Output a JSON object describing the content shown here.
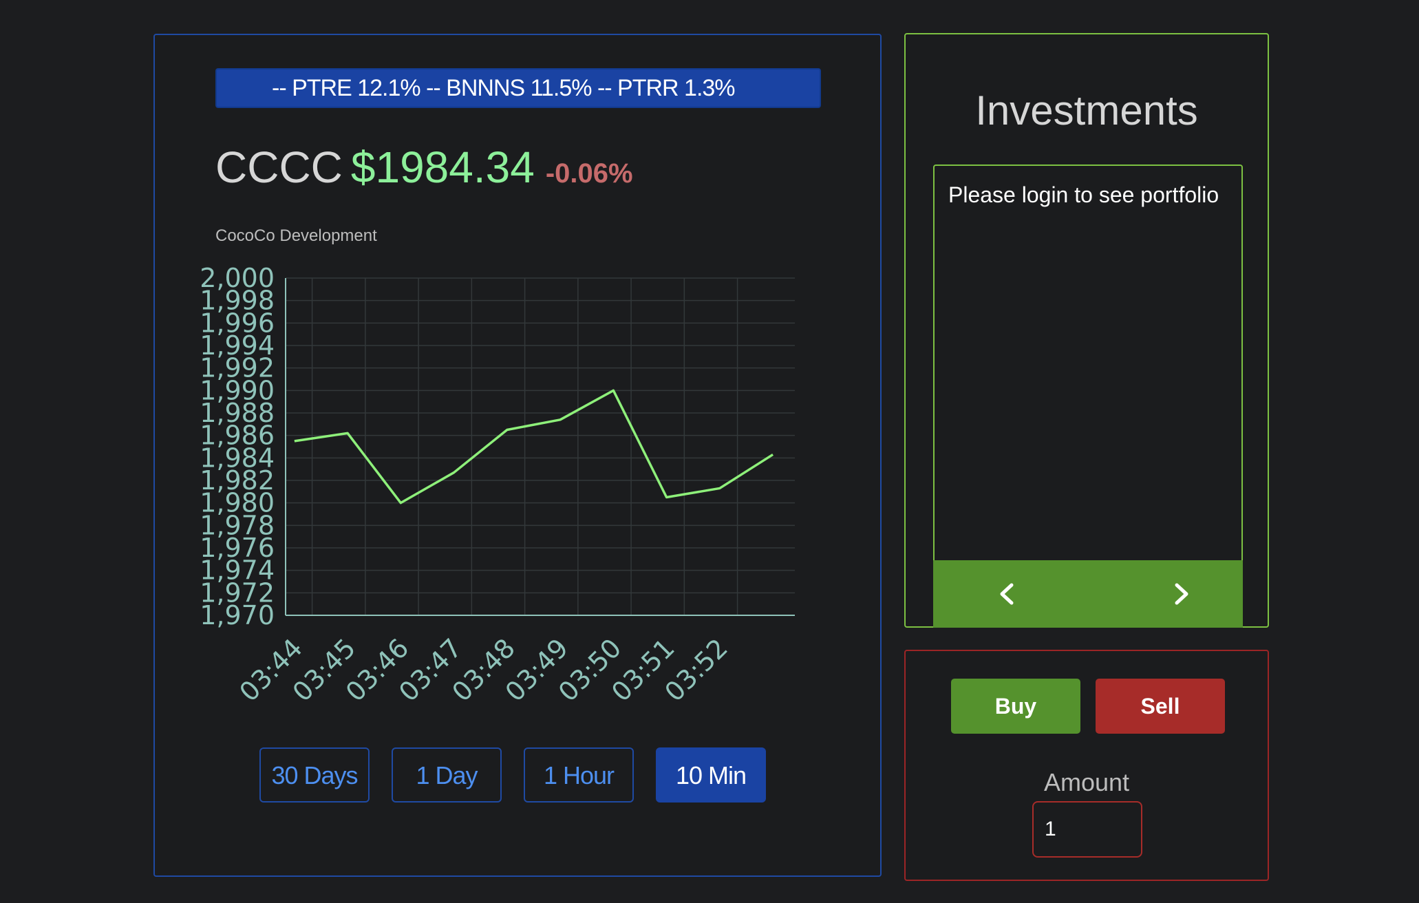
{
  "ticker": {
    "text": "-- PTRE 12.1% -- BNNNS 11.5% -- PTRR 1.3%"
  },
  "quote": {
    "symbol": "CCCC",
    "price": "$1984.34",
    "change": "-0.06%",
    "company": "CocoCo Development"
  },
  "chart_data": {
    "type": "line",
    "x": [
      "03:44",
      "03:45",
      "03:46",
      "03:47",
      "03:48",
      "03:49",
      "03:50",
      "03:51",
      "03:52"
    ],
    "y_ticks": [
      "2,000",
      "1,998",
      "1,996",
      "1,994",
      "1,992",
      "1,990",
      "1,988",
      "1,986",
      "1,984",
      "1,982",
      "1,980",
      "1,978",
      "1,976",
      "1,974",
      "1,972",
      "1,970"
    ],
    "ylim": [
      1970,
      2000
    ],
    "series": [
      {
        "points": [
          {
            "t": "03:43:40",
            "y": 1985.5
          },
          {
            "t": "03:44:40",
            "y": 1986.2
          },
          {
            "t": "03:45:40",
            "y": 1980.0
          },
          {
            "t": "03:46:40",
            "y": 1982.7
          },
          {
            "t": "03:47:40",
            "y": 1986.5
          },
          {
            "t": "03:48:40",
            "y": 1987.4
          },
          {
            "t": "03:49:40",
            "y": 1990.0
          },
          {
            "t": "03:50:40",
            "y": 1980.5
          },
          {
            "t": "03:51:40",
            "y": 1981.3
          },
          {
            "t": "03:52:40",
            "y": 1984.3
          }
        ]
      }
    ],
    "line_color": "#8ef07a",
    "grid": true
  },
  "ranges": [
    {
      "label": "30 Days",
      "active": false
    },
    {
      "label": "1 Day",
      "active": false
    },
    {
      "label": "1 Hour",
      "active": false
    },
    {
      "label": "10 Min",
      "active": true
    }
  ],
  "investments": {
    "title": "Investments",
    "message": "Please login to see portfolio",
    "prev_icon": "chevron-left-icon",
    "next_icon": "chevron-right-icon"
  },
  "trade": {
    "buy_label": "Buy",
    "sell_label": "Sell",
    "amount_label": "Amount",
    "amount_value": "1"
  },
  "colors": {
    "accent_blue": "#1a43a3",
    "green": "#55922d",
    "red": "#a72c29",
    "price_green": "#8df09a",
    "change_red": "#c66b6b"
  }
}
